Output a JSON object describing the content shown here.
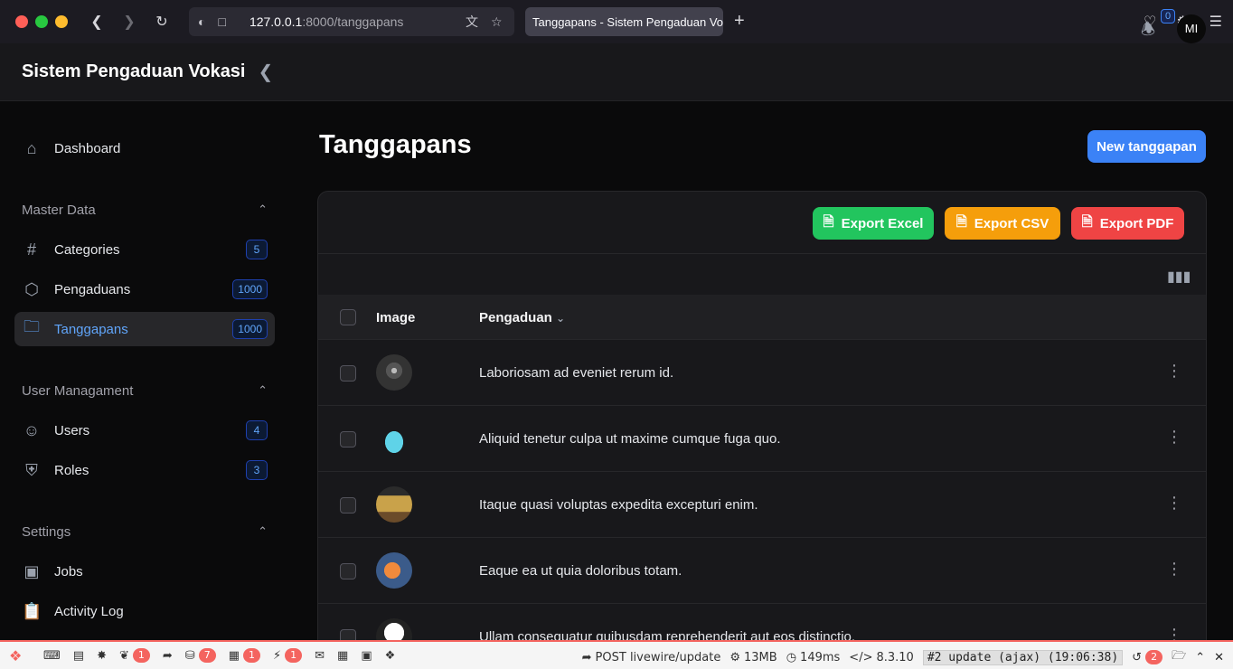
{
  "browser": {
    "url_host": "127.0.0.1",
    "url_path": ":8000/tanggapans",
    "tab_title": "Tanggapans - Sistem Pengaduan Vokasi"
  },
  "header": {
    "brand": "Sistem Pengaduan Vokasi",
    "notification_count": "0",
    "avatar_initials": "MI"
  },
  "sidebar": {
    "dashboard": "Dashboard",
    "groups": [
      {
        "label": "Master Data",
        "items": [
          {
            "label": "Categories",
            "badge": "5"
          },
          {
            "label": "Pengaduans",
            "badge": "1000"
          },
          {
            "label": "Tanggapans",
            "badge": "1000"
          }
        ]
      },
      {
        "label": "User Managament",
        "items": [
          {
            "label": "Users",
            "badge": "4"
          },
          {
            "label": "Roles",
            "badge": "3"
          }
        ]
      },
      {
        "label": "Settings",
        "items": [
          {
            "label": "Jobs"
          },
          {
            "label": "Activity Log"
          }
        ]
      }
    ]
  },
  "main": {
    "title": "Tanggapans",
    "new_button": "New tanggapan",
    "export_excel": "Export Excel",
    "export_csv": "Export CSV",
    "export_pdf": "Export PDF",
    "columns": {
      "image": "Image",
      "pengaduan": "Pengaduan"
    },
    "rows": [
      {
        "pengaduan": "Laboriosam ad eveniet rerum id."
      },
      {
        "pengaduan": "Aliquid tenetur culpa ut maxime cumque fuga quo."
      },
      {
        "pengaduan": "Itaque quasi voluptas expedita excepturi enim."
      },
      {
        "pengaduan": "Eaque ea ut quia doloribus totam."
      },
      {
        "pengaduan": "Ullam consequatur quibusdam reprehenderit aut eos distinctio."
      }
    ]
  },
  "debugbar": {
    "livewire_count": "1",
    "queries_count": "7",
    "models_count": "1",
    "events_count": "1",
    "request": "POST livewire/update",
    "memory": "13MB",
    "time": "149ms",
    "php_version": "8.3.10",
    "request_label": "#2 update (ajax) (19:06:38)",
    "history_count": "2"
  },
  "colors": {
    "primary": "#3b82f6",
    "excel": "#22c55e",
    "csv": "#f59e0b",
    "pdf": "#ef4444",
    "debugbar_accent": "#f4645f"
  }
}
